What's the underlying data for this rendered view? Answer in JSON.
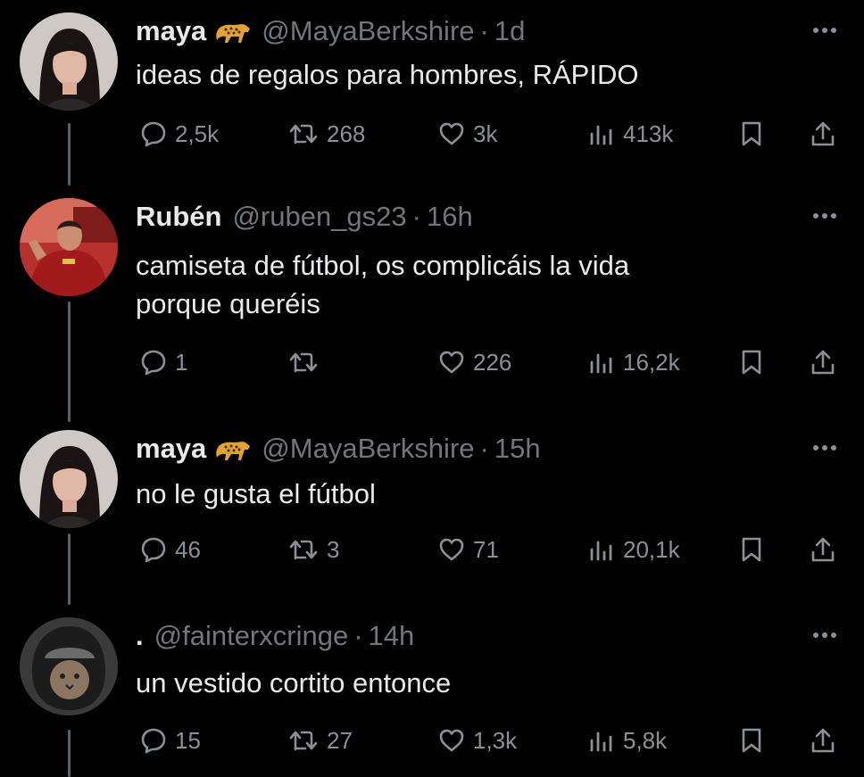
{
  "colors": {
    "background": "#000000",
    "text": "#e7e9ea",
    "muted": "#71767b",
    "icon": "#8b9096",
    "thread_line": "#5b6064"
  },
  "tweets": [
    {
      "name": "maya",
      "name_emoji": "leopard-emoji",
      "handle": "@MayaBerkshire",
      "separator": "·",
      "time": "1d",
      "lines": [
        "ideas de regalos para hombres, RÁPIDO"
      ],
      "replies": "2,5k",
      "retweets": "268",
      "likes": "3k",
      "views": "413k"
    },
    {
      "name": "Rubén",
      "handle": "@ruben_gs23",
      "separator": "·",
      "time": "16h",
      "lines": [
        "camiseta de fútbol, os complicáis la vida",
        "porque queréis"
      ],
      "replies": "1",
      "retweets": "",
      "likes": "226",
      "views": "16,2k"
    },
    {
      "name": "maya",
      "name_emoji": "leopard-emoji",
      "handle": "@MayaBerkshire",
      "separator": "·",
      "time": "15h",
      "lines": [
        "no le gusta el fútbol"
      ],
      "replies": "46",
      "retweets": "3",
      "likes": "71",
      "views": "20,1k"
    },
    {
      "name": ".",
      "handle": "@fainterxcringe",
      "separator": "·",
      "time": "14h",
      "lines": [
        "un vestido cortito entonce"
      ],
      "replies": "15",
      "retweets": "27",
      "likes": "1,3k",
      "views": "5,8k"
    }
  ]
}
